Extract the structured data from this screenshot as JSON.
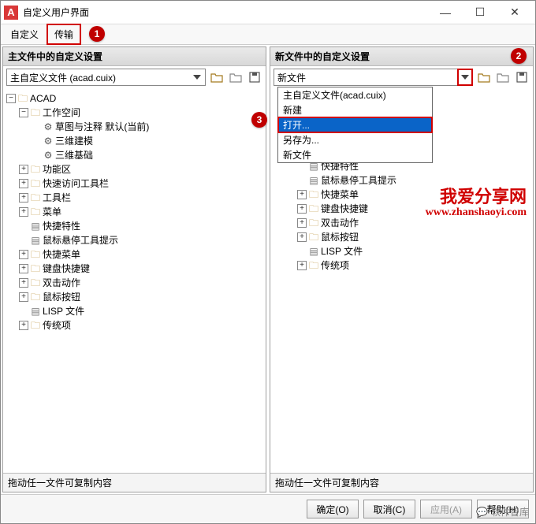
{
  "window": {
    "title": "自定义用户界面",
    "appIconLetter": "A",
    "controls": {
      "min": "—",
      "max": "☐",
      "close": "✕"
    }
  },
  "tabs": {
    "t0": "自定义",
    "t1": "传输"
  },
  "markers": {
    "m1": "1",
    "m2": "2",
    "m3": "3"
  },
  "left": {
    "header": "主文件中的自定义设置",
    "combo": "主自定义文件 (acad.cuix)",
    "tree": {
      "root": "ACAD",
      "ws": "工作空间",
      "ws1": "草图与注释  默认(当前)",
      "ws2": "三维建模",
      "ws3": "三维基础",
      "n1": "功能区",
      "n2": "快速访问工具栏",
      "n3": "工具栏",
      "n4": "菜单",
      "n5": "快捷特性",
      "n6": "鼠标悬停工具提示",
      "n7": "快捷菜单",
      "n8": "键盘快捷键",
      "n9": "双击动作",
      "n10": "鼠标按钮",
      "n11": "LISP 文件",
      "n12": "传统项"
    },
    "footer": "拖动任一文件可复制内容"
  },
  "right": {
    "header": "新文件中的自定义设置",
    "combo": "新文件",
    "dropdown": {
      "d0": "主自定义文件(acad.cuix)",
      "d1": "新建",
      "d2": "打开...",
      "d3": "另存为...",
      "d4": "新文件"
    },
    "tree": {
      "n5": "快捷特性",
      "n6": "鼠标悬停工具提示",
      "n7": "快捷菜单",
      "n8": "键盘快捷键",
      "n9": "双击动作",
      "n10": "鼠标按钮",
      "n11": "LISP 文件",
      "n12": "传统项"
    },
    "footer": "拖动任一文件可复制内容"
  },
  "buttons": {
    "ok": "确定(O)",
    "cancel": "取消(C)",
    "apply": "应用(A)",
    "help": "帮助(H)"
  },
  "brand": {
    "line1": "我爱分享网",
    "line2": "www.zhanshaoyi.com"
  },
  "corner": "软件智库"
}
